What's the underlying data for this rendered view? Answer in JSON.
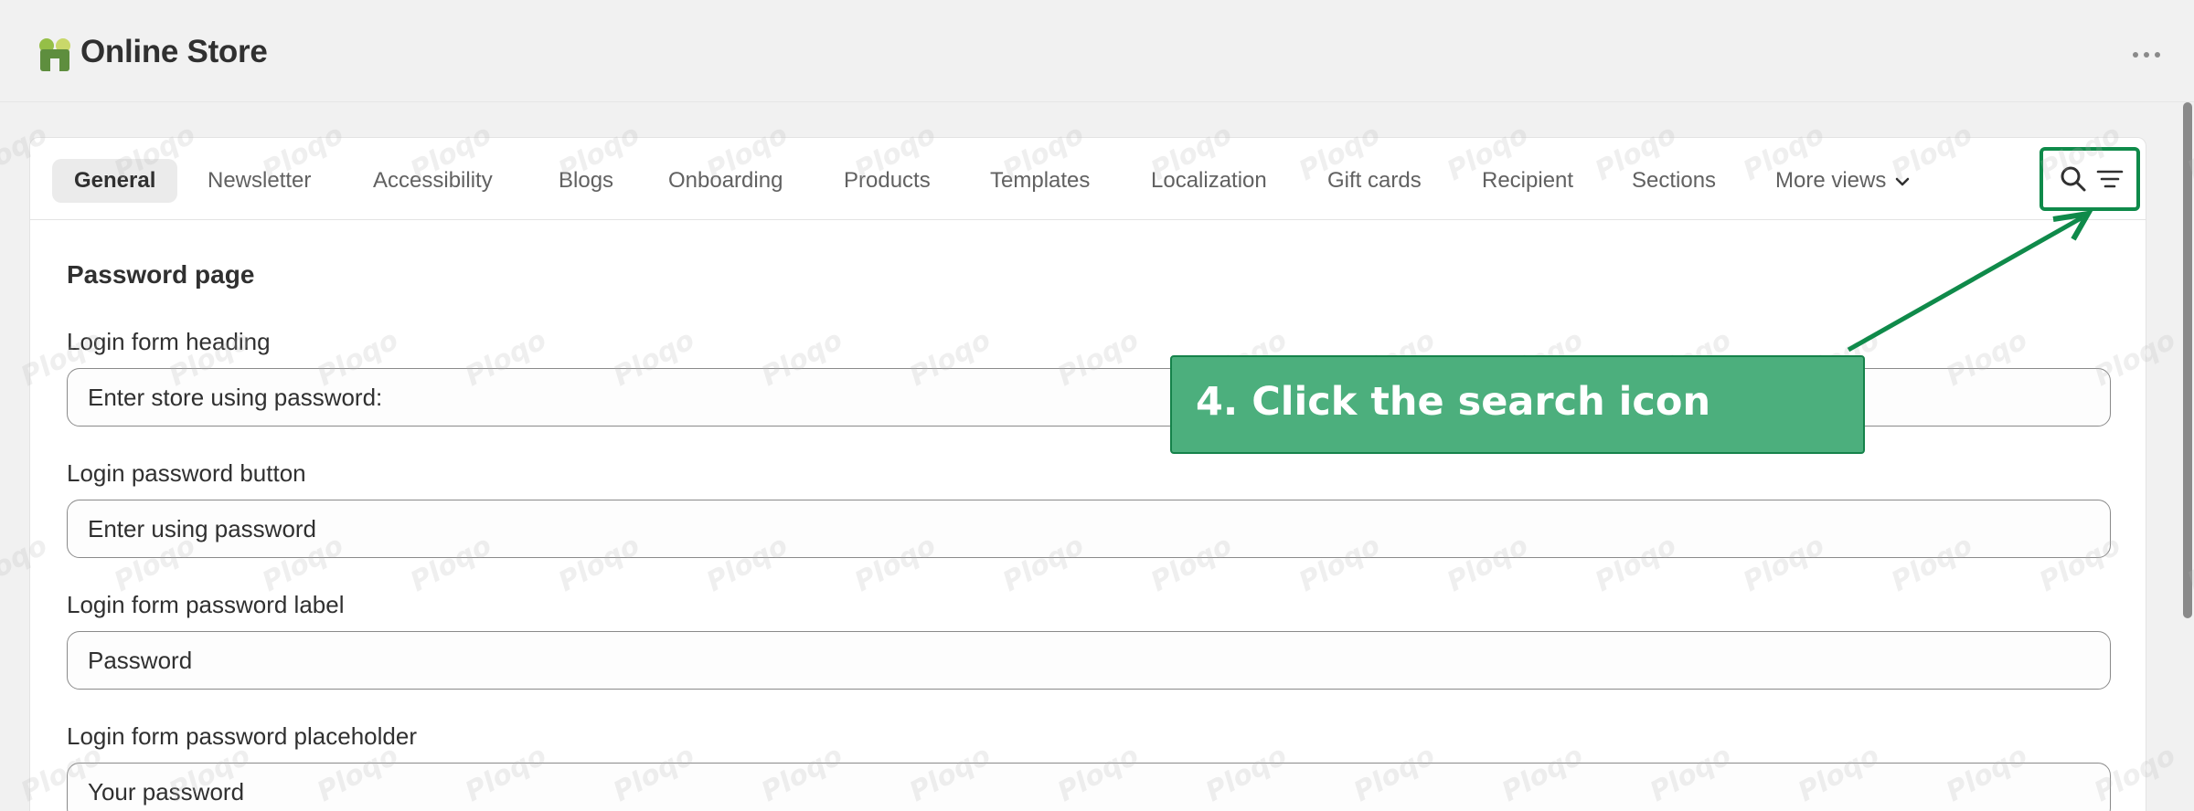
{
  "app": {
    "title": "Online Store",
    "logo_icon": "store-icon"
  },
  "tabs": [
    {
      "label": "General",
      "active": true
    },
    {
      "label": "Newsletter"
    },
    {
      "label": "Accessibility"
    },
    {
      "label": "Blogs"
    },
    {
      "label": "Onboarding"
    },
    {
      "label": "Products"
    },
    {
      "label": "Templates"
    },
    {
      "label": "Localization"
    },
    {
      "label": "Gift cards"
    },
    {
      "label": "Recipient"
    },
    {
      "label": "Sections"
    },
    {
      "label": "More views"
    }
  ],
  "section": {
    "title": "Password page"
  },
  "fields": [
    {
      "label": "Login form heading",
      "value": "Enter store using password:"
    },
    {
      "label": "Login password button",
      "value": "Enter using password"
    },
    {
      "label": "Login form password label",
      "value": "Password"
    },
    {
      "label": "Login form password placeholder",
      "value": "Your password"
    }
  ],
  "callout": {
    "text": "4. Click the search icon"
  },
  "watermark": "Ploqo",
  "colors": {
    "accent": "#0f8a4a",
    "callout_bg": "#4caf7d",
    "active_tab_bg": "#ebebeb"
  }
}
